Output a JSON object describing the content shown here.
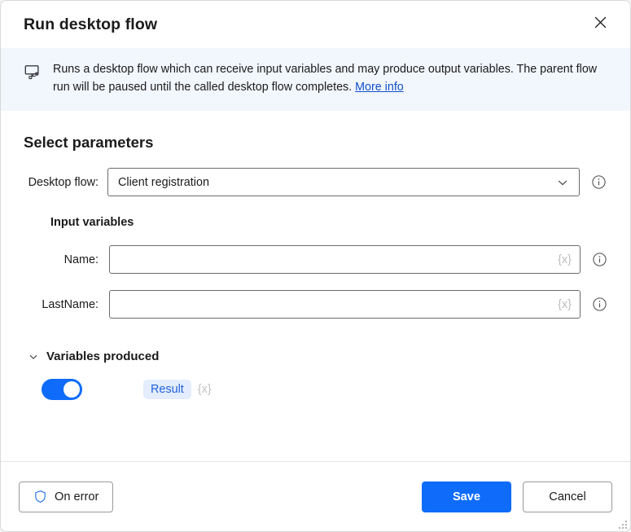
{
  "dialog": {
    "title": "Run desktop flow",
    "close_icon": "close-icon"
  },
  "banner": {
    "icon": "desktop-flow-icon",
    "text": "Runs a desktop flow which can receive input variables and may produce output variables. The parent flow run will be paused until the called desktop flow completes. ",
    "link_label": "More info"
  },
  "main": {
    "section_title": "Select parameters",
    "desktop_flow": {
      "label": "Desktop flow:",
      "value": "Client registration",
      "chevron_icon": "chevron-down-icon",
      "info_icon": "info-circle-icon"
    },
    "input_variables_title": "Input variables",
    "input_variables": [
      {
        "label": "Name:",
        "value": "",
        "placeholder": "",
        "variable_icon": "{x}",
        "info_icon": "info-circle-icon"
      },
      {
        "label": "LastName:",
        "value": "",
        "placeholder": "",
        "variable_icon": "{x}",
        "info_icon": "info-circle-icon"
      }
    ],
    "variables_produced": {
      "caret_icon": "chevron-down-icon",
      "title": "Variables produced",
      "toggle_state": "on",
      "token_label": "Result",
      "variable_icon": "{x}"
    }
  },
  "footer": {
    "on_error_label": "On error",
    "on_error_icon": "shield-icon",
    "save_label": "Save",
    "cancel_label": "Cancel",
    "resize_grip": "resize-grip-icon"
  },
  "colors": {
    "accent": "#0f6cfa",
    "banner_bg": "#f2f6fd",
    "link": "#1050c8",
    "token_bg": "#e3edfd",
    "token_text": "#2162d9"
  }
}
